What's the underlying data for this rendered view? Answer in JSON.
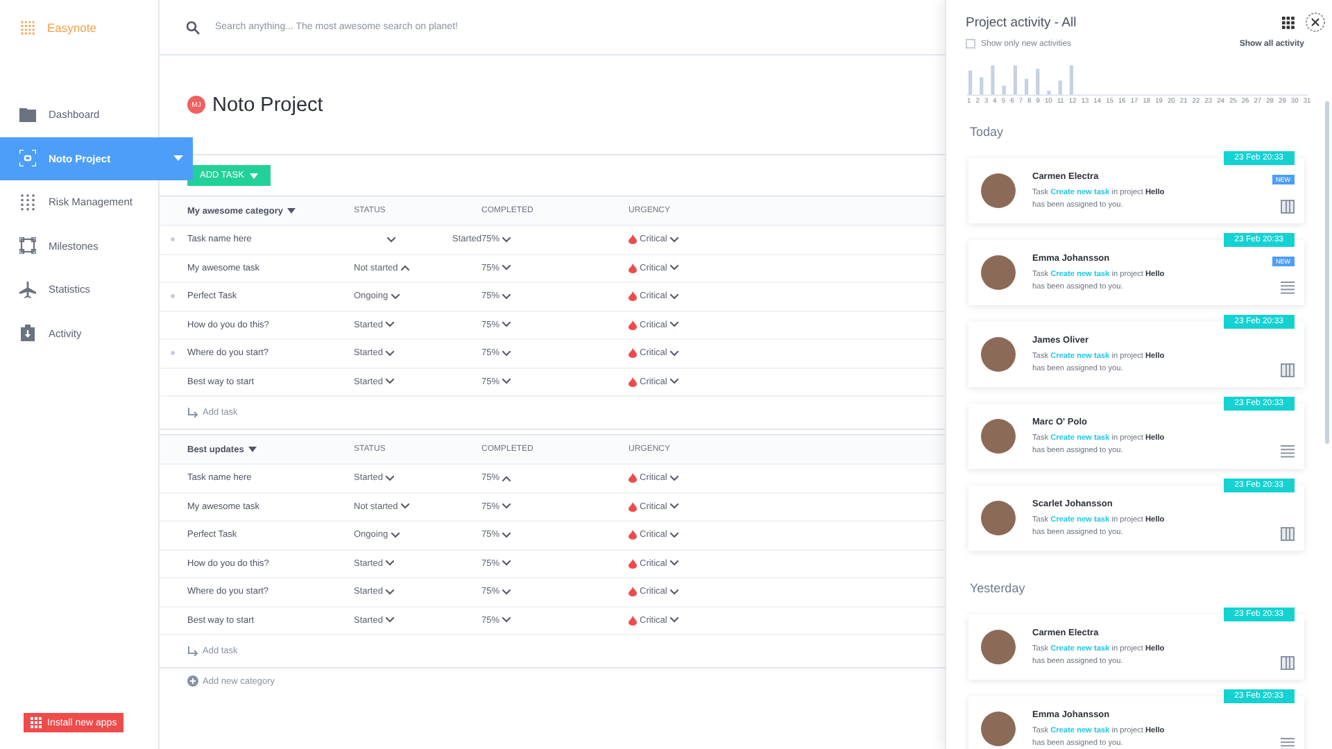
{
  "brand": {
    "name": "Easynote"
  },
  "search": {
    "placeholder": "Search anything... The most awesome search on planet!"
  },
  "sidebar": {
    "items": [
      {
        "label": "Dashboard",
        "kind": "folder",
        "selected": false
      },
      {
        "label": "Noto Project",
        "kind": "focus",
        "selected": true
      },
      {
        "label": "Risk Management",
        "kind": "grid",
        "selected": false
      },
      {
        "label": "Milestones",
        "kind": "frame",
        "selected": false
      },
      {
        "label": "Statistics",
        "kind": "plane",
        "selected": false
      },
      {
        "label": "Activity",
        "kind": "clipboard",
        "selected": false
      }
    ],
    "install_button": "Install new apps"
  },
  "project": {
    "initials": "MJ",
    "title": "Noto Project",
    "add_task_button": "ADD TASK"
  },
  "categories": [
    {
      "name": "My awesome category",
      "columns": [
        "STATUS",
        "COMPLETED",
        "URGENCY"
      ],
      "add_task": "Add task",
      "rows": [
        {
          "name": "Task name here",
          "marked": true,
          "kind": "shifted",
          "status": "Started",
          "status_open": false,
          "completed": "75%",
          "completed_open": false,
          "urgency": "Critical"
        },
        {
          "name": "My awesome task",
          "marked": false,
          "kind": "plain",
          "status": "Not started",
          "status_open": true,
          "completed": "75%",
          "completed_open": false,
          "urgency": "Critical"
        },
        {
          "name": "Perfect Task",
          "marked": true,
          "kind": "plain",
          "status": "Ongoing",
          "status_open": false,
          "completed": "75%",
          "completed_open": false,
          "urgency": "Critical"
        },
        {
          "name": "How do you do this?",
          "marked": false,
          "kind": "plain",
          "status": "Started",
          "status_open": false,
          "completed": "75%",
          "completed_open": false,
          "urgency": "Critical"
        },
        {
          "name": "Where do you start?",
          "marked": true,
          "kind": "plain",
          "status": "Started",
          "status_open": false,
          "completed": "75%",
          "completed_open": false,
          "urgency": "Critical"
        },
        {
          "name": "Best way to start",
          "marked": false,
          "kind": "plain",
          "status": "Started",
          "status_open": false,
          "completed": "75%",
          "completed_open": false,
          "urgency": "Critical"
        }
      ]
    },
    {
      "name": "Best updates",
      "columns": [
        "STATUS",
        "COMPLETED",
        "URGENCY"
      ],
      "add_task": "Add task",
      "rows": [
        {
          "name": "Task name here",
          "marked": false,
          "kind": "plain",
          "status": "Started",
          "status_open": false,
          "completed": "75%",
          "completed_open": true,
          "urgency": "Critical"
        },
        {
          "name": "My awesome task",
          "marked": false,
          "kind": "plain",
          "status": "Not started",
          "status_open": false,
          "completed": "75%",
          "completed_open": false,
          "urgency": "Critical"
        },
        {
          "name": "Perfect Task",
          "marked": false,
          "kind": "plain",
          "status": "Ongoing",
          "status_open": false,
          "completed": "75%",
          "completed_open": false,
          "urgency": "Critical"
        },
        {
          "name": "How do you do this?",
          "marked": false,
          "kind": "plain",
          "status": "Started",
          "status_open": false,
          "completed": "75%",
          "completed_open": false,
          "urgency": "Critical"
        },
        {
          "name": "Where do you start?",
          "marked": false,
          "kind": "plain",
          "status": "Started",
          "status_open": false,
          "completed": "75%",
          "completed_open": false,
          "urgency": "Critical"
        },
        {
          "name": "Best way to start",
          "marked": false,
          "kind": "plain",
          "status": "Started",
          "status_open": false,
          "completed": "75%",
          "completed_open": false,
          "urgency": "Critical"
        }
      ]
    }
  ],
  "add_category": "Add new category",
  "activity_panel": {
    "title": "Project activity - All",
    "filter": {
      "label": "Show only new activities",
      "checked": false
    },
    "show_all": "Show all activity",
    "days": [
      "1",
      "2",
      "3",
      "4",
      "5",
      "6",
      "7",
      "8",
      "9",
      "10",
      "11",
      "12",
      "13",
      "14",
      "15",
      "16",
      "17",
      "18",
      "19",
      "20",
      "21",
      "22",
      "23",
      "24",
      "25",
      "26",
      "27",
      "28",
      "29",
      "30",
      "31"
    ],
    "sections": [
      {
        "title": "Today",
        "items": [
          {
            "name": "Carmen Electra",
            "date": "23 Feb 20:33",
            "is_new": true,
            "new_label": "NEW",
            "text_before": "Task",
            "link": "Create new task",
            "text_after": "in project **Hello** has been assigned to you.",
            "kind": "columns"
          },
          {
            "name": "Emma Johansson",
            "date": "23 Feb 20:33",
            "is_new": true,
            "new_label": "NEW",
            "text_before": "Task",
            "link": "Create new task",
            "text_after": "in project **Hello** has been assigned to you.",
            "kind": "list"
          },
          {
            "name": "James Oliver",
            "date": "23 Feb 20:33",
            "is_new": false,
            "text_before": "Task",
            "link": "Create new task",
            "text_after": "in project **Hello** has been assigned to you.",
            "kind": "columns"
          },
          {
            "name": "Marc O' Polo",
            "date": "23 Feb 20:33",
            "is_new": false,
            "text_before": "Task",
            "link": "Create new task",
            "text_after": "in project **Hello** has been assigned to you.",
            "kind": "list"
          },
          {
            "name": "Scarlet Johansson",
            "date": "23 Feb 20:33",
            "is_new": false,
            "text_before": "Task",
            "link": "Create new task",
            "text_after": "in project **Hello** has been assigned to you.",
            "kind": "columns"
          }
        ]
      },
      {
        "title": "Yesterday",
        "items": [
          {
            "name": "Carmen Electra",
            "date": "23 Feb 20:33",
            "is_new": false,
            "text_before": "Task",
            "link": "Create new task",
            "text_after": "in project **Hello** has been assigned to you.",
            "kind": "columns"
          },
          {
            "name": "Emma Johansson",
            "date": "23 Feb 20:33",
            "is_new": false,
            "text_before": "Task",
            "link": "Create new task",
            "text_after": "in project **Hello** has been assigned to you.",
            "kind": "list"
          }
        ]
      }
    ]
  }
}
